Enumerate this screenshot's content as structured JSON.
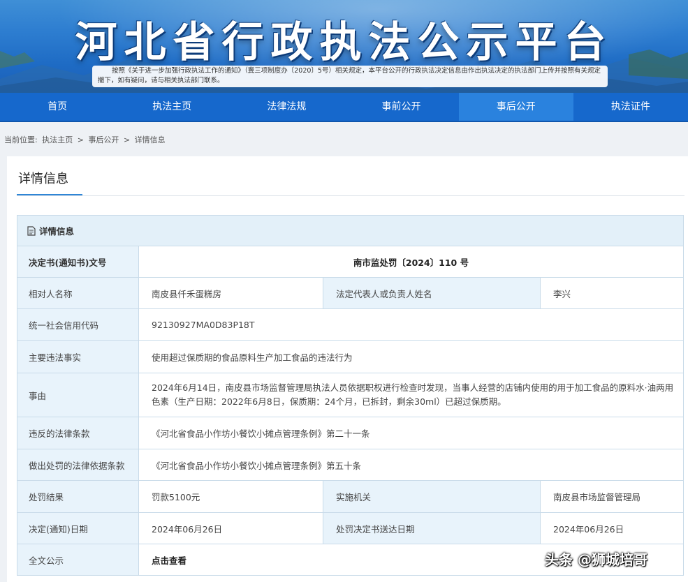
{
  "banner": {
    "title": "河北省行政执法公示平台",
    "notice": "按照《关于进一步加强行政执法工作的通知》（冀三项制度办〔2020〕5号）相关规定，本平台公开的行政执法决定信息由作出执法决定的执法部门上传并按照有关规定撤下，如有疑问，请与相关执法部门联系。"
  },
  "nav": {
    "items": [
      {
        "label": "首页"
      },
      {
        "label": "执法主页"
      },
      {
        "label": "法律法规"
      },
      {
        "label": "事前公开"
      },
      {
        "label": "事后公开"
      },
      {
        "label": "执法证件"
      }
    ],
    "active": "事后公开"
  },
  "breadcrumb": {
    "prefix": "当前位置:",
    "items": [
      "执法主页",
      "事后公开",
      "详情信息"
    ],
    "separator": ">"
  },
  "panel": {
    "title": "详情信息"
  },
  "detail": {
    "caption": "详情信息",
    "decision_no": {
      "label": "决定书(通知书)文号",
      "value": "南市监处罚〔2024〕110 号"
    },
    "party": {
      "label": "相对人名称",
      "value": "南皮县仟禾蛋糕房"
    },
    "legal_rep": {
      "label": "法定代表人或负责人姓名",
      "value": "李兴"
    },
    "credit_code": {
      "label": "统一社会信用代码",
      "value": "92130927MA0D83P18T"
    },
    "main_fact": {
      "label": "主要违法事实",
      "value": "使用超过保质期的食品原料生产加工食品的违法行为"
    },
    "cause": {
      "label": "事由",
      "value": "2024年6月14日，南皮县市场监督管理局执法人员依据职权进行检查时发现，当事人经营的店铺内使用的用于加工食品的原料水·油两用色素（生产日期：2022年6月8日，保质期：24个月，已拆封，剩余30ml）已超过保质期。"
    },
    "violated_law": {
      "label": "违反的法律条款",
      "value": "《河北省食品小作坊小餐饮小摊点管理条例》第二十一条"
    },
    "penalty_basis": {
      "label": "做出处罚的法律依据条款",
      "value": "《河北省食品小作坊小餐饮小摊点管理条例》第五十条"
    },
    "penalty_result": {
      "label": "处罚结果",
      "value": "罚款5100元"
    },
    "agency": {
      "label": "实施机关",
      "value": "南皮县市场监督管理局"
    },
    "decision_date": {
      "label": "决定(通知)日期",
      "value": "2024年06月26日"
    },
    "delivery_date": {
      "label": "处罚决定书送达日期",
      "value": "2024年06月26日"
    },
    "full_text": {
      "label": "全文公示",
      "value": "点击查看"
    }
  },
  "watermark": "头条 @狮城培哥",
  "colors": {
    "nav_bg": "#1668cc",
    "nav_active": "#2a82de",
    "label_bg": "#e8f3fb",
    "border": "#c9dbe9",
    "accent": "#2f86d6"
  }
}
